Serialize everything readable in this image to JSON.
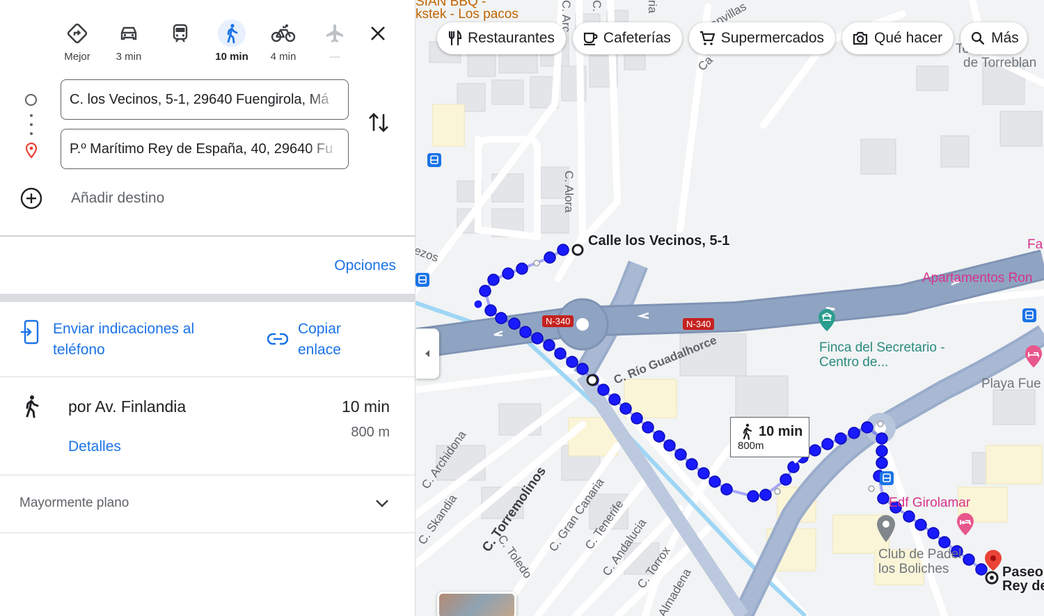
{
  "colors": {
    "accent": "#1a73e8",
    "route": "#1a1aff",
    "highway": "#8fa4c2",
    "poi_pink": "#d6338a",
    "poi_teal": "#2a8a7f",
    "dest_pin": "#ea4335"
  },
  "travel_modes": [
    {
      "id": "best",
      "label": "Mejor",
      "icon": "diamond-directions-icon",
      "active": false
    },
    {
      "id": "car",
      "label": "3 min",
      "icon": "car-icon",
      "active": false
    },
    {
      "id": "transit",
      "label": "",
      "icon": "train-icon",
      "active": false
    },
    {
      "id": "walk",
      "label": "10 min",
      "icon": "walking-icon",
      "active": true
    },
    {
      "id": "bike",
      "label": "4 min",
      "icon": "bicycle-icon",
      "active": false
    },
    {
      "id": "flight",
      "label": "—",
      "icon": "airplane-icon",
      "active": false
    }
  ],
  "directions": {
    "origin": "C. los Vecinos, 5-1, 29640 Fuengirola, Má",
    "destination": "P.º Marítimo Rey de España, 40, 29640 Fu",
    "add_destination": "Añadir destino",
    "options": "Opciones"
  },
  "actions": {
    "send_to_phone": "Enviar indicaciones al teléfono",
    "copy_link": "Copiar enlace"
  },
  "route": {
    "via": "por Av. Finlandia",
    "time": "10 min",
    "distance": "800 m",
    "details": "Detalles",
    "terrain": "Mayormente plano"
  },
  "map": {
    "chips": [
      {
        "label": "Restaurantes",
        "icon": "fork-knife-icon"
      },
      {
        "label": "Cafeterías",
        "icon": "coffee-icon"
      },
      {
        "label": "Supermercados",
        "icon": "cart-icon"
      },
      {
        "label": "Qué hacer",
        "icon": "camera-icon"
      },
      {
        "label": "Más",
        "icon": "search-icon"
      }
    ],
    "time_callout": {
      "time": "10 min",
      "distance": "800m"
    },
    "origin_label": "Calle los Vecinos, 5-1",
    "dest_label_line1": "Paseo",
    "dest_label_line2": "Rey de",
    "road_shields": [
      "N-340",
      "N-340"
    ],
    "streets": {
      "alora": "C. Alora",
      "rio": "C. Río Guadalhorce",
      "archidona": "C. Archidona",
      "skandia": "C. Skandia",
      "torremolinos": "C. Torremolinos",
      "toledo": "C. Toledo",
      "gran_canaria": "C. Gran Canaria",
      "tenerife": "C. Tenerife",
      "andalucia": "C. Andalucia",
      "torrox": "C. Torrox",
      "almadena": "Almadena",
      "arc": "C. Arc",
      "c_top": "C.",
      "ria": "ria",
      "anvillas": "anvillas",
      "ca": "Ca",
      "ezos": "ezos"
    },
    "pois": {
      "top_left": "SIAN BBQ -",
      "top_left2": "kstek - Los pacos",
      "torre1": "Tor",
      "torre2": "de Torreblan",
      "fa": "Fa",
      "apartamentos": "Apartamentos Ron",
      "finca1": "Finca del Secretario -",
      "finca2": "Centro de...",
      "playa": "Playa Fue",
      "girolamar": "Edf Girolamar",
      "padel1": "Club de Padel",
      "padel2": "los Boliches"
    }
  }
}
